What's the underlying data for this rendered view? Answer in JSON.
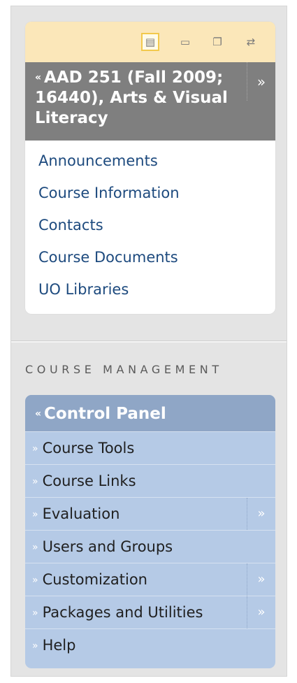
{
  "course_menu": {
    "title": "AAD 251 (Fall 2009; 16440), Arts & Visual Literacy",
    "collapse_glyph": "«",
    "expand_glyph": "»",
    "toolbar_icons": [
      "list-view-icon",
      "folder-view-icon",
      "new-window-icon",
      "refresh-icon"
    ],
    "links": [
      {
        "label": "Announcements"
      },
      {
        "label": "Course Information"
      },
      {
        "label": "Contacts"
      },
      {
        "label": "Course Documents"
      },
      {
        "label": "UO Libraries"
      }
    ]
  },
  "course_management": {
    "section_label": "COURSE MANAGEMENT",
    "control_panel_title": "Control Panel",
    "items": [
      {
        "label": "Course Tools",
        "has_submenu": false
      },
      {
        "label": "Course Links",
        "has_submenu": false
      },
      {
        "label": "Evaluation",
        "has_submenu": true
      },
      {
        "label": "Users and Groups",
        "has_submenu": false
      },
      {
        "label": "Customization",
        "has_submenu": true
      },
      {
        "label": "Packages and Utilities",
        "has_submenu": true
      },
      {
        "label": "Help",
        "has_submenu": false
      }
    ]
  },
  "colors": {
    "toolbar_bg": "#fbe7b9",
    "course_header_bg": "#7f7f7f",
    "link_color": "#1d4a7e",
    "control_panel_header": "#8fa6c6",
    "control_panel_body": "#b5cae6"
  }
}
